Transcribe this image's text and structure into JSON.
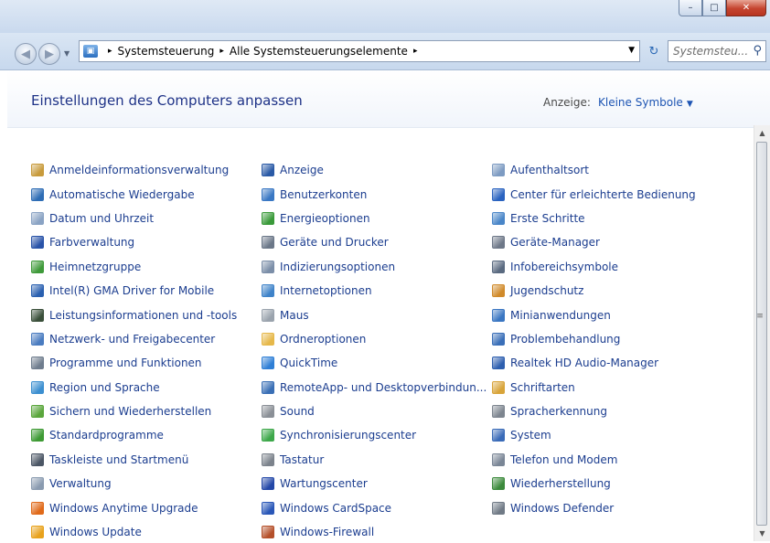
{
  "window": {
    "min_glyph": "–",
    "max_glyph": "□",
    "close_glyph": "✕"
  },
  "nav": {
    "back_glyph": "◀",
    "forward_glyph": "▶",
    "breadcrumb": [
      "Systemsteuerung",
      "Alle Systemsteuerungselemente"
    ],
    "separator": "▸",
    "search_placeholder": "Systemsteu..."
  },
  "header": {
    "title": "Einstellungen des Computers anpassen",
    "view_label": "Anzeige:",
    "view_value": "Kleine Symbole"
  },
  "columns": [
    [
      {
        "label": "Anmeldeinformationsverwaltung",
        "icon": "credential-icon",
        "color": "#c89b3c"
      },
      {
        "label": "Automatische Wiedergabe",
        "icon": "autoplay-icon",
        "color": "#2e6db5"
      },
      {
        "label": "Datum und Uhrzeit",
        "icon": "clock-icon",
        "color": "#8aa3c4"
      },
      {
        "label": "Farbverwaltung",
        "icon": "color-monitor-icon",
        "color": "#2953a8"
      },
      {
        "label": "Heimnetzgruppe",
        "icon": "homegroup-icon",
        "color": "#3f9a3a"
      },
      {
        "label": "Intel(R) GMA Driver for Mobile",
        "icon": "intel-icon",
        "color": "#2a60b0"
      },
      {
        "label": "Leistungsinformationen und -tools",
        "icon": "performance-icon",
        "color": "#3a4f3a"
      },
      {
        "label": "Netzwerk- und Freigabecenter",
        "icon": "network-icon",
        "color": "#4a7cc0"
      },
      {
        "label": "Programme und Funktionen",
        "icon": "programs-icon",
        "color": "#6f7d8e"
      },
      {
        "label": "Region und Sprache",
        "icon": "globe-icon",
        "color": "#3c8fd0"
      },
      {
        "label": "Sichern und Wiederherstellen",
        "icon": "backup-icon",
        "color": "#5aa63c"
      },
      {
        "label": "Standardprogramme",
        "icon": "default-programs-icon",
        "color": "#3e9a34"
      },
      {
        "label": "Taskleiste und Startmenü",
        "icon": "taskbar-icon",
        "color": "#4b5665"
      },
      {
        "label": "Verwaltung",
        "icon": "admin-tools-icon",
        "color": "#8a9bb0"
      },
      {
        "label": "Windows Anytime Upgrade",
        "icon": "windows-flag-icon",
        "color": "#e06a1a"
      },
      {
        "label": "Windows Update",
        "icon": "windows-update-icon",
        "color": "#e8a21c"
      }
    ],
    [
      {
        "label": "Anzeige",
        "icon": "display-icon",
        "color": "#2a5aa6"
      },
      {
        "label": "Benutzerkonten",
        "icon": "user-accounts-icon",
        "color": "#3a78c4"
      },
      {
        "label": "Energieoptionen",
        "icon": "power-icon",
        "color": "#3a9a3a"
      },
      {
        "label": "Geräte und Drucker",
        "icon": "printer-icon",
        "color": "#6b7788"
      },
      {
        "label": "Indizierungsoptionen",
        "icon": "indexing-icon",
        "color": "#7b8ea8"
      },
      {
        "label": "Internetoptionen",
        "icon": "internet-options-icon",
        "color": "#3f83c9"
      },
      {
        "label": "Maus",
        "icon": "mouse-icon",
        "color": "#9aa3ad"
      },
      {
        "label": "Ordneroptionen",
        "icon": "folder-icon",
        "color": "#e6b84a"
      },
      {
        "label": "QuickTime",
        "icon": "quicktime-icon",
        "color": "#2f7fd6"
      },
      {
        "label": "RemoteApp- und Desktopverbindun...",
        "icon": "remoteapp-icon",
        "color": "#3a6fb5"
      },
      {
        "label": "Sound",
        "icon": "speaker-icon",
        "color": "#8a8f96"
      },
      {
        "label": "Synchronisierungscenter",
        "icon": "sync-icon",
        "color": "#3da84a"
      },
      {
        "label": "Tastatur",
        "icon": "keyboard-icon",
        "color": "#7c838c"
      },
      {
        "label": "Wartungscenter",
        "icon": "action-center-flag-icon",
        "color": "#2448a8"
      },
      {
        "label": "Windows CardSpace",
        "icon": "cardspace-icon",
        "color": "#2a57b8"
      },
      {
        "label": "Windows-Firewall",
        "icon": "firewall-icon",
        "color": "#b5502a"
      }
    ],
    [
      {
        "label": "Aufenthaltsort",
        "icon": "location-icon",
        "color": "#7d9bc2"
      },
      {
        "label": "Center für erleichterte Bedienung",
        "icon": "ease-of-access-icon",
        "color": "#2a63c0"
      },
      {
        "label": "Erste Schritte",
        "icon": "getting-started-icon",
        "color": "#4a86c8"
      },
      {
        "label": "Geräte-Manager",
        "icon": "device-manager-icon",
        "color": "#6e7888"
      },
      {
        "label": "Infobereichsymbole",
        "icon": "notification-icons-icon",
        "color": "#5a6a80"
      },
      {
        "label": "Jugendschutz",
        "icon": "parental-controls-icon",
        "color": "#d08a2a"
      },
      {
        "label": "Minianwendungen",
        "icon": "gadgets-icon",
        "color": "#3a76c2"
      },
      {
        "label": "Problembehandlung",
        "icon": "troubleshooting-icon",
        "color": "#3a6fb8"
      },
      {
        "label": "Realtek HD Audio-Manager",
        "icon": "realtek-icon",
        "color": "#2e5faf"
      },
      {
        "label": "Schriftarten",
        "icon": "fonts-icon",
        "color": "#d8a43a"
      },
      {
        "label": "Spracherkennung",
        "icon": "microphone-icon",
        "color": "#7d858f"
      },
      {
        "label": "System",
        "icon": "system-icon",
        "color": "#3a6bb8"
      },
      {
        "label": "Telefon und Modem",
        "icon": "phone-modem-icon",
        "color": "#7a8696"
      },
      {
        "label": "Wiederherstellung",
        "icon": "recovery-icon",
        "color": "#3c8a3c"
      },
      {
        "label": "Windows Defender",
        "icon": "defender-icon",
        "color": "#707a86"
      }
    ]
  ]
}
